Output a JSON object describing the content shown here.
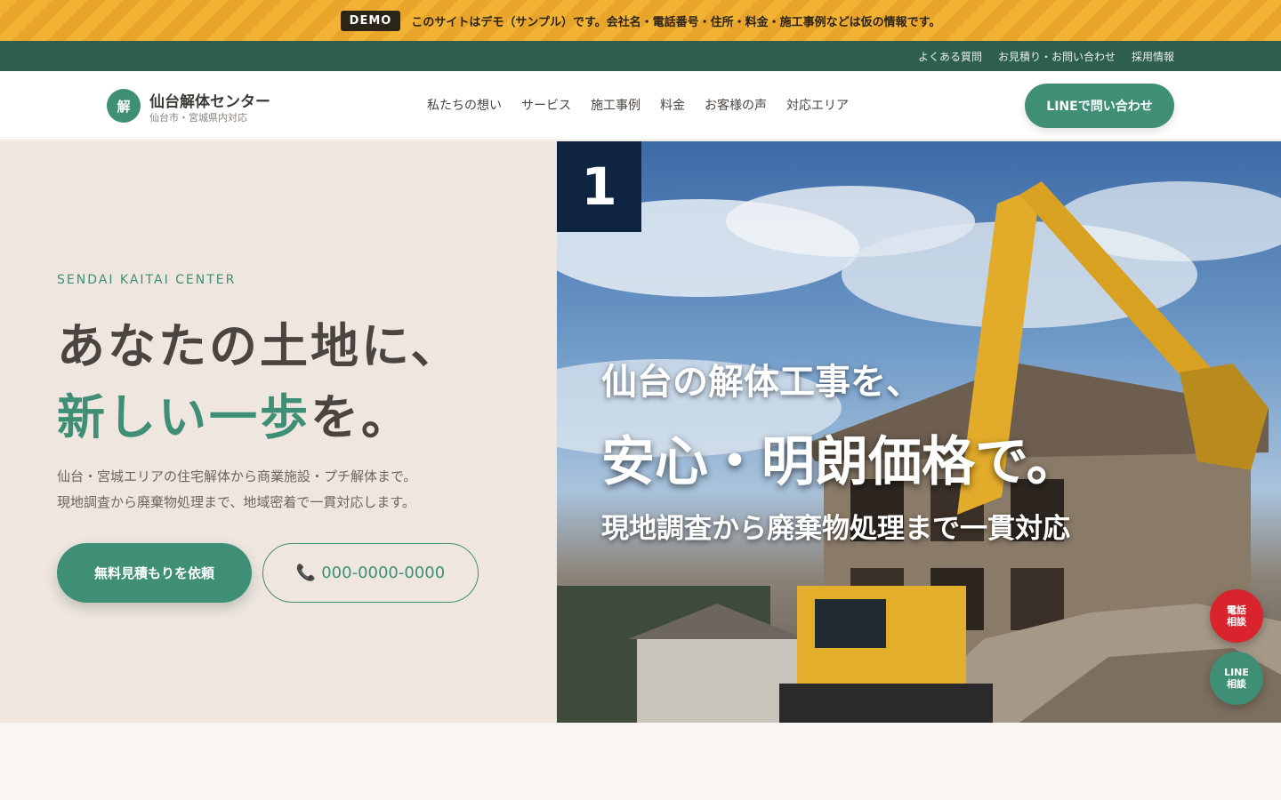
{
  "demo": {
    "badge": "DEMO",
    "text": "このサイトはデモ（サンプル）です。会社名・電話番号・住所・料金・施工事例などは仮の情報です。"
  },
  "util_nav": [
    {
      "label": "よくある質問"
    },
    {
      "label": "お見積り・お問い合わせ"
    },
    {
      "label": "採用情報"
    }
  ],
  "header": {
    "logo_mark": "解",
    "logo_name": "仙台解体センター",
    "logo_sub": "仙台市・宮城県内対応",
    "nav": [
      {
        "label": "私たちの想い"
      },
      {
        "label": "サービス"
      },
      {
        "label": "施工事例"
      },
      {
        "label": "料金"
      },
      {
        "label": "お客様の声"
      },
      {
        "label": "対応エリア"
      }
    ],
    "line_button": "LINEで問い合わせ"
  },
  "hero": {
    "eyebrow": "SENDAI KAITAI CENTER",
    "headline_line1": "あなたの土地に、",
    "headline_accent": "新しい一歩",
    "headline_rest": "を。",
    "lead_line1": "仙台・宮城エリアの住宅解体から商業施設・プチ解体まで。",
    "lead_line2": "現地調査から廃棄物処理まで、地域密着で一貫対応します。",
    "cta_primary": "無料見積もりを依頼",
    "cta_phone": "000-0000-0000",
    "phone_icon": "phone-icon"
  },
  "hero_image": {
    "slide_number": "1",
    "line1": "仙台の解体工事を、",
    "line2": "安心・明朗価格で。",
    "line3": "現地調査から廃棄物処理まで一貫対応"
  },
  "floating": {
    "tel_line1": "電話",
    "tel_line2": "相談",
    "line_line1": "LINE",
    "line_line2": "相談"
  },
  "colors": {
    "accent": "#3f8f76",
    "dark_green": "#2e5e4e",
    "demo_yellow": "#f2b233",
    "tel_red": "#d9232d",
    "hero_bg": "#efe6e0"
  }
}
